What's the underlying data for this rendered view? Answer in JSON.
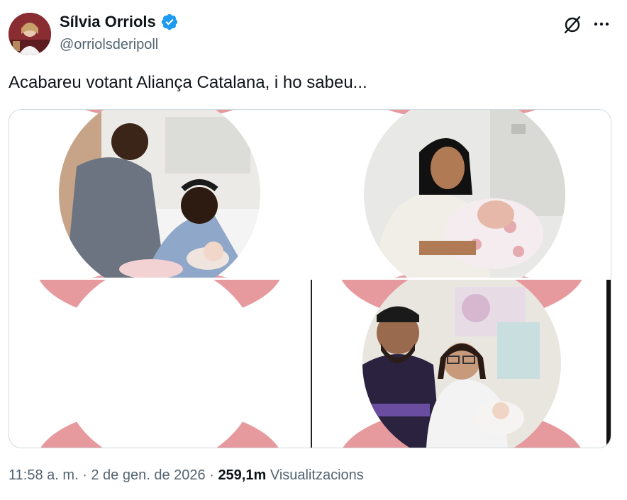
{
  "author": {
    "name": "Sílvia Orriols",
    "handle": "@orriolsderipoll",
    "verified": true
  },
  "tweet": {
    "text": "Acabareu votant Aliança Catalana, i ho sabeu..."
  },
  "media": {
    "count": 4,
    "accent_color": "#e79a9e"
  },
  "meta": {
    "time": "11:58 a. m.",
    "separator1": "·",
    "date": "2 de gen. de 2026",
    "separator2": "·",
    "views_count": "259,1m",
    "views_label": "Visualitzacions"
  },
  "icons": {
    "verified": "verified-badge-icon",
    "grok": "grok-icon",
    "more": "more-icon"
  }
}
